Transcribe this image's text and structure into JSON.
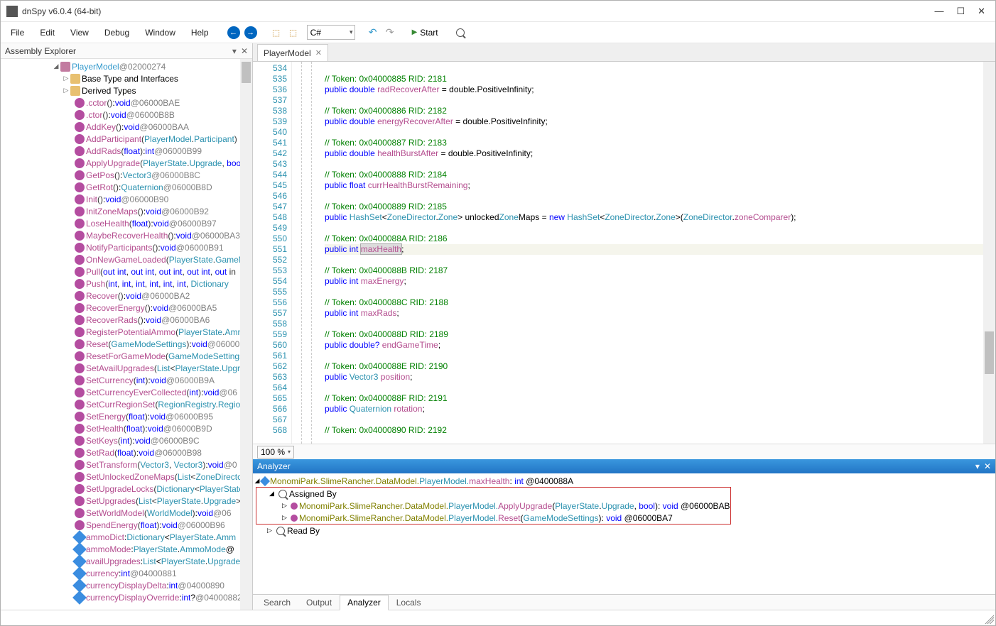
{
  "window": {
    "title": "dnSpy v6.0.4 (64-bit)"
  },
  "menubar": [
    "File",
    "Edit",
    "View",
    "Debug",
    "Window",
    "Help"
  ],
  "toolbar": {
    "language": "C#",
    "start": "Start"
  },
  "assembly_explorer": {
    "title": "Assembly Explorer",
    "root": {
      "name": "PlayerModel",
      "addr": "@02000274"
    },
    "folders": [
      "Base Type and Interfaces",
      "Derived Types"
    ],
    "members": [
      {
        "name": ".cctor",
        "sig": "()",
        "ret": "void",
        "addr": "@06000BAE",
        "kind": "m"
      },
      {
        "name": ".ctor",
        "sig": "()",
        "ret": "void",
        "addr": "@06000B8B",
        "kind": "m"
      },
      {
        "name": "AddKey",
        "sig": "()",
        "ret": "void",
        "addr": "@06000BAA",
        "kind": "m"
      },
      {
        "name": "AddParticipant",
        "sig": "(PlayerModel.Participant)",
        "ret": "",
        "addr": "",
        "kind": "m"
      },
      {
        "name": "AddRads",
        "sig": "(float)",
        "ret": "int",
        "addr": "@06000B99",
        "kind": "m"
      },
      {
        "name": "ApplyUpgrade",
        "sig": "(PlayerState.Upgrade, bool",
        "ret": "",
        "addr": "",
        "kind": "m"
      },
      {
        "name": "GetPos",
        "sig": "()",
        "ret": "Vector3",
        "addr": "@06000B8C",
        "kind": "m"
      },
      {
        "name": "GetRot",
        "sig": "()",
        "ret": "Quaternion",
        "addr": "@06000B8D",
        "kind": "m"
      },
      {
        "name": "Init",
        "sig": "()",
        "ret": "void",
        "addr": "@06000B90",
        "kind": "m"
      },
      {
        "name": "InitZoneMaps",
        "sig": "()",
        "ret": "void",
        "addr": "@06000B92",
        "kind": "m"
      },
      {
        "name": "LoseHealth",
        "sig": "(float)",
        "ret": "void",
        "addr": "@06000B97",
        "kind": "m"
      },
      {
        "name": "MaybeRecoverHealth",
        "sig": "()",
        "ret": "void",
        "addr": "@06000BA3",
        "kind": "m"
      },
      {
        "name": "NotifyParticipants",
        "sig": "()",
        "ret": "void",
        "addr": "@06000B91",
        "kind": "m"
      },
      {
        "name": "OnNewGameLoaded",
        "sig": "(PlayerState.GameM",
        "ret": "",
        "addr": "",
        "kind": "m"
      },
      {
        "name": "Pull",
        "sig": "(out int, out int, out int, out int, out in",
        "ret": "",
        "addr": "",
        "kind": "m"
      },
      {
        "name": "Push",
        "sig": "(int, int, int, int, int, int, Dictionary<F",
        "ret": "",
        "addr": "",
        "kind": "m"
      },
      {
        "name": "Recover",
        "sig": "()",
        "ret": "void",
        "addr": "@06000BA2",
        "kind": "m"
      },
      {
        "name": "RecoverEnergy",
        "sig": "()",
        "ret": "void",
        "addr": "@06000BA5",
        "kind": "m"
      },
      {
        "name": "RecoverRads",
        "sig": "()",
        "ret": "void",
        "addr": "@06000BA6",
        "kind": "m"
      },
      {
        "name": "RegisterPotentialAmmo",
        "sig": "(PlayerState.Amm",
        "ret": "",
        "addr": "",
        "kind": "m"
      },
      {
        "name": "Reset",
        "sig": "(GameModeSettings)",
        "ret": "void",
        "addr": "@06000",
        "kind": "m"
      },
      {
        "name": "ResetForGameMode",
        "sig": "(GameModeSettings",
        "ret": "",
        "addr": "",
        "kind": "m"
      },
      {
        "name": "SetAvailUpgrades",
        "sig": "(List<PlayerState.Upgra",
        "ret": "",
        "addr": "",
        "kind": "m"
      },
      {
        "name": "SetCurrency",
        "sig": "(int)",
        "ret": "void",
        "addr": "@06000B9A",
        "kind": "m"
      },
      {
        "name": "SetCurrencyEverCollected",
        "sig": "(int)",
        "ret": "void",
        "addr": "@06",
        "kind": "m"
      },
      {
        "name": "SetCurrRegionSet",
        "sig": "(RegionRegistry.Region",
        "ret": "",
        "addr": "",
        "kind": "m"
      },
      {
        "name": "SetEnergy",
        "sig": "(float)",
        "ret": "void",
        "addr": "@06000B95",
        "kind": "m"
      },
      {
        "name": "SetHealth",
        "sig": "(float)",
        "ret": "void",
        "addr": "@06000B9D",
        "kind": "m"
      },
      {
        "name": "SetKeys",
        "sig": "(int)",
        "ret": "void",
        "addr": "@06000B9C",
        "kind": "m"
      },
      {
        "name": "SetRad",
        "sig": "(float)",
        "ret": "void",
        "addr": "@06000B98",
        "kind": "m"
      },
      {
        "name": "SetTransform",
        "sig": "(Vector3, Vector3)",
        "ret": "void",
        "addr": "@0",
        "kind": "m"
      },
      {
        "name": "SetUnlockedZoneMaps",
        "sig": "(List<ZoneDirectc",
        "ret": "",
        "addr": "",
        "kind": "m"
      },
      {
        "name": "SetUpgradeLocks",
        "sig": "(Dictionary<PlayerState",
        "ret": "",
        "addr": "",
        "kind": "m"
      },
      {
        "name": "SetUpgrades",
        "sig": "(List<PlayerState.Upgrade>)",
        "ret": "",
        "addr": "",
        "kind": "m"
      },
      {
        "name": "SetWorldModel",
        "sig": "(WorldModel)",
        "ret": "void",
        "addr": "@06",
        "kind": "m"
      },
      {
        "name": "SpendEnergy",
        "sig": "(float)",
        "ret": "void",
        "addr": "@06000B96",
        "kind": "m"
      },
      {
        "name": "ammoDict",
        "sig": "",
        "ret": "Dictionary<PlayerState.Amm",
        "addr": "",
        "kind": "f"
      },
      {
        "name": "ammoMode",
        "sig": "",
        "ret": "PlayerState.AmmoMode @",
        "addr": "",
        "kind": "f"
      },
      {
        "name": "availUpgrades",
        "sig": "",
        "ret": "List<PlayerState.Upgrade",
        "addr": "",
        "kind": "f"
      },
      {
        "name": "currency",
        "sig": "",
        "ret": "int",
        "addr": "@04000881",
        "kind": "f"
      },
      {
        "name": "currencyDisplayDelta",
        "sig": "",
        "ret": "int",
        "addr": "@04000890",
        "kind": "f"
      },
      {
        "name": "currencyDisplayOverride",
        "sig": "",
        "ret": "int?",
        "addr": "@04000882",
        "kind": "f"
      }
    ]
  },
  "editor": {
    "tab": "PlayerModel",
    "first_line": 534,
    "zoom": "100 %",
    "lines": [
      {
        "n": 534,
        "t": "cont",
        "text": ""
      },
      {
        "n": 535,
        "t": "comment",
        "text": "// Token: 0x04000885 RID: 2181"
      },
      {
        "n": 536,
        "t": "decl",
        "kw": "public",
        "ty": "double",
        "name": "radRecoverAfter",
        "rest": " = double.PositiveInfinity;"
      },
      {
        "n": 537,
        "t": "blank",
        "text": ""
      },
      {
        "n": 538,
        "t": "comment",
        "text": "// Token: 0x04000886 RID: 2182"
      },
      {
        "n": 539,
        "t": "decl",
        "kw": "public",
        "ty": "double",
        "name": "energyRecoverAfter",
        "rest": " = double.PositiveInfinity;"
      },
      {
        "n": 540,
        "t": "blank",
        "text": ""
      },
      {
        "n": 541,
        "t": "comment",
        "text": "// Token: 0x04000887 RID: 2183"
      },
      {
        "n": 542,
        "t": "decl",
        "kw": "public",
        "ty": "double",
        "name": "healthBurstAfter",
        "rest": " = double.PositiveInfinity;"
      },
      {
        "n": 543,
        "t": "blank",
        "text": ""
      },
      {
        "n": 544,
        "t": "comment",
        "text": "// Token: 0x04000888 RID: 2184"
      },
      {
        "n": 545,
        "t": "decl",
        "kw": "public",
        "ty": "float",
        "name": "currHealthBurstRemaining",
        "rest": ";"
      },
      {
        "n": 546,
        "t": "blank",
        "text": ""
      },
      {
        "n": 547,
        "t": "comment",
        "text": "// Token: 0x04000889 RID: 2185"
      },
      {
        "n": 548,
        "t": "code",
        "text": "public HashSet<ZoneDirector.Zone> unlockedZoneMaps = new HashSet<ZoneDirector.Zone>(ZoneDirector.zoneComparer);"
      },
      {
        "n": 549,
        "t": "blank",
        "text": ""
      },
      {
        "n": 550,
        "t": "comment",
        "text": "// Token: 0x0400088A RID: 2186"
      },
      {
        "n": 551,
        "t": "hl",
        "kw": "public",
        "ty": "int",
        "name": "maxHealth",
        "rest": ";"
      },
      {
        "n": 552,
        "t": "blank",
        "text": ""
      },
      {
        "n": 553,
        "t": "comment",
        "text": "// Token: 0x0400088B RID: 2187"
      },
      {
        "n": 554,
        "t": "decl",
        "kw": "public",
        "ty": "int",
        "name": "maxEnergy",
        "rest": ";"
      },
      {
        "n": 555,
        "t": "blank",
        "text": ""
      },
      {
        "n": 556,
        "t": "comment",
        "text": "// Token: 0x0400088C RID: 2188"
      },
      {
        "n": 557,
        "t": "decl",
        "kw": "public",
        "ty": "int",
        "name": "maxRads",
        "rest": ";"
      },
      {
        "n": 558,
        "t": "blank",
        "text": ""
      },
      {
        "n": 559,
        "t": "comment",
        "text": "// Token: 0x0400088D RID: 2189"
      },
      {
        "n": 560,
        "t": "decl",
        "kw": "public",
        "ty": "double?",
        "name": "endGameTime",
        "rest": ";"
      },
      {
        "n": 561,
        "t": "blank",
        "text": ""
      },
      {
        "n": 562,
        "t": "comment",
        "text": "// Token: 0x0400088E RID: 2190"
      },
      {
        "n": 563,
        "t": "decl",
        "kw": "public",
        "ty": "Vector3",
        "name": "position",
        "rest": ";"
      },
      {
        "n": 564,
        "t": "blank",
        "text": ""
      },
      {
        "n": 565,
        "t": "comment",
        "text": "// Token: 0x0400088F RID: 2191"
      },
      {
        "n": 566,
        "t": "decl",
        "kw": "public",
        "ty": "Quaternion",
        "name": "rotation",
        "rest": ";"
      },
      {
        "n": 567,
        "t": "blank",
        "text": ""
      },
      {
        "n": 568,
        "t": "comment",
        "text": "// Token: 0x04000890 RID: 2192"
      }
    ]
  },
  "analyzer": {
    "title": "Analyzer",
    "root": {
      "ns": "MonomiPark.SlimeRancher.DataModel.",
      "cls": "PlayerModel.",
      "field": "maxHealth",
      "sig": " : int @0400088A"
    },
    "assigned_by": "Assigned By",
    "read_by": "Read By",
    "refs": [
      {
        "ns": "MonomiPark.SlimeRancher.DataModel.",
        "cls": "PlayerModel.",
        "m": "ApplyUpgrade",
        "arg": "(PlayerState.Upgrade, bool)",
        "ret": " : void @06000BAB"
      },
      {
        "ns": "MonomiPark.SlimeRancher.DataModel.",
        "cls": "PlayerModel.",
        "m": "Reset",
        "arg": "(GameModeSettings)",
        "ret": " : void @06000BA7"
      }
    ]
  },
  "bottom_tabs": [
    "Search",
    "Output",
    "Analyzer",
    "Locals"
  ],
  "active_bottom_tab": "Analyzer"
}
